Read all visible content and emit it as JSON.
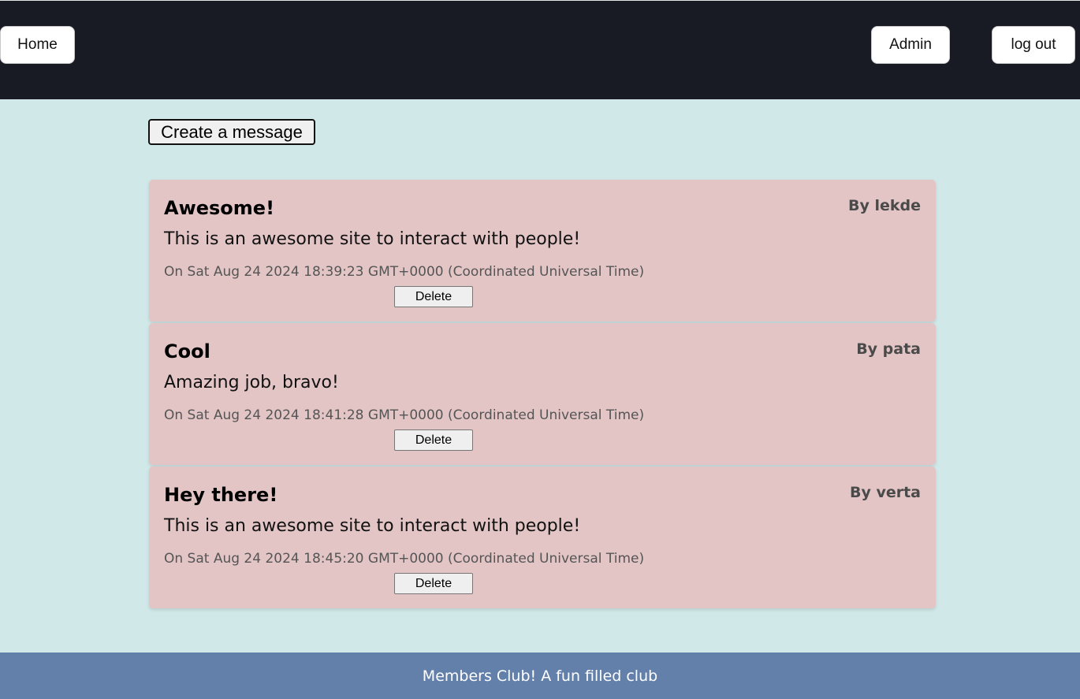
{
  "nav": {
    "home_label": "Home",
    "admin_label": "Admin",
    "logout_label": "log out"
  },
  "create_button_label": "Create a message",
  "messages": [
    {
      "title": "Awesome!",
      "author": "By lekde",
      "body": "This is an awesome site to interact with people!",
      "date": "On Sat Aug 24 2024 18:39:23 GMT+0000 (Coordinated Universal Time)",
      "delete_label": "Delete"
    },
    {
      "title": "Cool",
      "author": "By pata",
      "body": "Amazing job, bravo!",
      "date": "On Sat Aug 24 2024 18:41:28 GMT+0000 (Coordinated Universal Time)",
      "delete_label": "Delete"
    },
    {
      "title": "Hey there!",
      "author": "By verta",
      "body": "This is an awesome site to interact with people!",
      "date": "On Sat Aug 24 2024 18:45:20 GMT+0000 (Coordinated Universal Time)",
      "delete_label": "Delete"
    }
  ],
  "footer": {
    "text": "Members Club! A fun filled club"
  },
  "colors": {
    "topbar": "#181b23",
    "page_background": "#d1e8e9",
    "card_background": "#e3c5c6",
    "footer_background": "#6380ab"
  }
}
